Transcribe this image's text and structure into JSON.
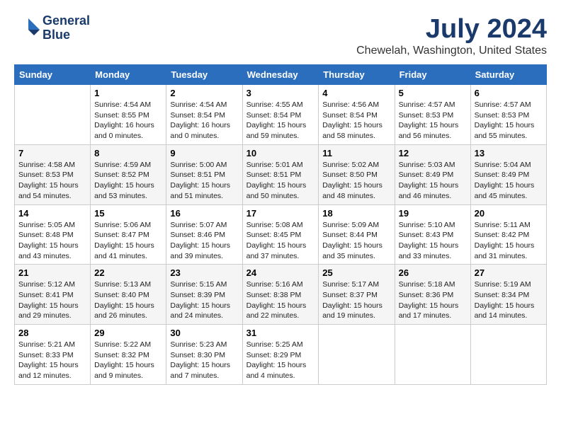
{
  "header": {
    "logo_line1": "General",
    "logo_line2": "Blue",
    "month": "July 2024",
    "location": "Chewelah, Washington, United States"
  },
  "days_of_week": [
    "Sunday",
    "Monday",
    "Tuesday",
    "Wednesday",
    "Thursday",
    "Friday",
    "Saturday"
  ],
  "weeks": [
    [
      {
        "day": "",
        "sunrise": "",
        "sunset": "",
        "daylight": ""
      },
      {
        "day": "1",
        "sunrise": "Sunrise: 4:54 AM",
        "sunset": "Sunset: 8:55 PM",
        "daylight": "Daylight: 16 hours and 0 minutes."
      },
      {
        "day": "2",
        "sunrise": "Sunrise: 4:54 AM",
        "sunset": "Sunset: 8:54 PM",
        "daylight": "Daylight: 16 hours and 0 minutes."
      },
      {
        "day": "3",
        "sunrise": "Sunrise: 4:55 AM",
        "sunset": "Sunset: 8:54 PM",
        "daylight": "Daylight: 15 hours and 59 minutes."
      },
      {
        "day": "4",
        "sunrise": "Sunrise: 4:56 AM",
        "sunset": "Sunset: 8:54 PM",
        "daylight": "Daylight: 15 hours and 58 minutes."
      },
      {
        "day": "5",
        "sunrise": "Sunrise: 4:57 AM",
        "sunset": "Sunset: 8:53 PM",
        "daylight": "Daylight: 15 hours and 56 minutes."
      },
      {
        "day": "6",
        "sunrise": "Sunrise: 4:57 AM",
        "sunset": "Sunset: 8:53 PM",
        "daylight": "Daylight: 15 hours and 55 minutes."
      }
    ],
    [
      {
        "day": "7",
        "sunrise": "Sunrise: 4:58 AM",
        "sunset": "Sunset: 8:53 PM",
        "daylight": "Daylight: 15 hours and 54 minutes."
      },
      {
        "day": "8",
        "sunrise": "Sunrise: 4:59 AM",
        "sunset": "Sunset: 8:52 PM",
        "daylight": "Daylight: 15 hours and 53 minutes."
      },
      {
        "day": "9",
        "sunrise": "Sunrise: 5:00 AM",
        "sunset": "Sunset: 8:51 PM",
        "daylight": "Daylight: 15 hours and 51 minutes."
      },
      {
        "day": "10",
        "sunrise": "Sunrise: 5:01 AM",
        "sunset": "Sunset: 8:51 PM",
        "daylight": "Daylight: 15 hours and 50 minutes."
      },
      {
        "day": "11",
        "sunrise": "Sunrise: 5:02 AM",
        "sunset": "Sunset: 8:50 PM",
        "daylight": "Daylight: 15 hours and 48 minutes."
      },
      {
        "day": "12",
        "sunrise": "Sunrise: 5:03 AM",
        "sunset": "Sunset: 8:49 PM",
        "daylight": "Daylight: 15 hours and 46 minutes."
      },
      {
        "day": "13",
        "sunrise": "Sunrise: 5:04 AM",
        "sunset": "Sunset: 8:49 PM",
        "daylight": "Daylight: 15 hours and 45 minutes."
      }
    ],
    [
      {
        "day": "14",
        "sunrise": "Sunrise: 5:05 AM",
        "sunset": "Sunset: 8:48 PM",
        "daylight": "Daylight: 15 hours and 43 minutes."
      },
      {
        "day": "15",
        "sunrise": "Sunrise: 5:06 AM",
        "sunset": "Sunset: 8:47 PM",
        "daylight": "Daylight: 15 hours and 41 minutes."
      },
      {
        "day": "16",
        "sunrise": "Sunrise: 5:07 AM",
        "sunset": "Sunset: 8:46 PM",
        "daylight": "Daylight: 15 hours and 39 minutes."
      },
      {
        "day": "17",
        "sunrise": "Sunrise: 5:08 AM",
        "sunset": "Sunset: 8:45 PM",
        "daylight": "Daylight: 15 hours and 37 minutes."
      },
      {
        "day": "18",
        "sunrise": "Sunrise: 5:09 AM",
        "sunset": "Sunset: 8:44 PM",
        "daylight": "Daylight: 15 hours and 35 minutes."
      },
      {
        "day": "19",
        "sunrise": "Sunrise: 5:10 AM",
        "sunset": "Sunset: 8:43 PM",
        "daylight": "Daylight: 15 hours and 33 minutes."
      },
      {
        "day": "20",
        "sunrise": "Sunrise: 5:11 AM",
        "sunset": "Sunset: 8:42 PM",
        "daylight": "Daylight: 15 hours and 31 minutes."
      }
    ],
    [
      {
        "day": "21",
        "sunrise": "Sunrise: 5:12 AM",
        "sunset": "Sunset: 8:41 PM",
        "daylight": "Daylight: 15 hours and 29 minutes."
      },
      {
        "day": "22",
        "sunrise": "Sunrise: 5:13 AM",
        "sunset": "Sunset: 8:40 PM",
        "daylight": "Daylight: 15 hours and 26 minutes."
      },
      {
        "day": "23",
        "sunrise": "Sunrise: 5:15 AM",
        "sunset": "Sunset: 8:39 PM",
        "daylight": "Daylight: 15 hours and 24 minutes."
      },
      {
        "day": "24",
        "sunrise": "Sunrise: 5:16 AM",
        "sunset": "Sunset: 8:38 PM",
        "daylight": "Daylight: 15 hours and 22 minutes."
      },
      {
        "day": "25",
        "sunrise": "Sunrise: 5:17 AM",
        "sunset": "Sunset: 8:37 PM",
        "daylight": "Daylight: 15 hours and 19 minutes."
      },
      {
        "day": "26",
        "sunrise": "Sunrise: 5:18 AM",
        "sunset": "Sunset: 8:36 PM",
        "daylight": "Daylight: 15 hours and 17 minutes."
      },
      {
        "day": "27",
        "sunrise": "Sunrise: 5:19 AM",
        "sunset": "Sunset: 8:34 PM",
        "daylight": "Daylight: 15 hours and 14 minutes."
      }
    ],
    [
      {
        "day": "28",
        "sunrise": "Sunrise: 5:21 AM",
        "sunset": "Sunset: 8:33 PM",
        "daylight": "Daylight: 15 hours and 12 minutes."
      },
      {
        "day": "29",
        "sunrise": "Sunrise: 5:22 AM",
        "sunset": "Sunset: 8:32 PM",
        "daylight": "Daylight: 15 hours and 9 minutes."
      },
      {
        "day": "30",
        "sunrise": "Sunrise: 5:23 AM",
        "sunset": "Sunset: 8:30 PM",
        "daylight": "Daylight: 15 hours and 7 minutes."
      },
      {
        "day": "31",
        "sunrise": "Sunrise: 5:25 AM",
        "sunset": "Sunset: 8:29 PM",
        "daylight": "Daylight: 15 hours and 4 minutes."
      },
      {
        "day": "",
        "sunrise": "",
        "sunset": "",
        "daylight": ""
      },
      {
        "day": "",
        "sunrise": "",
        "sunset": "",
        "daylight": ""
      },
      {
        "day": "",
        "sunrise": "",
        "sunset": "",
        "daylight": ""
      }
    ]
  ]
}
